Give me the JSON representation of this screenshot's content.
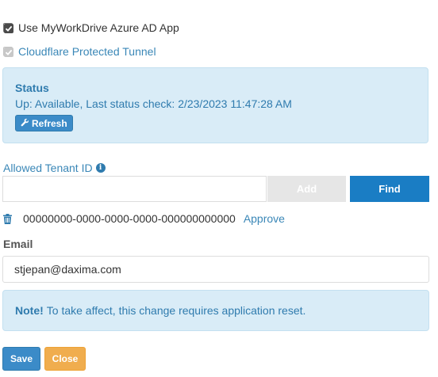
{
  "options": {
    "azure_app": {
      "label": "Use MyWorkDrive Azure AD App",
      "checked": true
    },
    "cloudflare": {
      "label": "Cloudflare Protected Tunnel",
      "checked": true,
      "disabled": true
    }
  },
  "status": {
    "title": "Status",
    "text": "Up: Available, Last status check: 2/23/2023 11:47:28 AM",
    "refresh_label": "Refresh"
  },
  "tenant": {
    "label": "Allowed Tenant ID",
    "input_value": "",
    "add_label": "Add",
    "find_label": "Find",
    "entries": [
      {
        "id": "00000000-0000-0000-0000-000000000000",
        "action": "Approve"
      }
    ]
  },
  "email": {
    "label": "Email",
    "value": "stjepan@daxima.com"
  },
  "note": {
    "prefix": "Note!",
    "text": "To take affect, this change requires application reset."
  },
  "footer": {
    "save_label": "Save",
    "close_label": "Close"
  },
  "colors": {
    "accent": "#1a7dc4",
    "info_bg": "#d9ecf7",
    "warning": "#f0ad4e"
  }
}
